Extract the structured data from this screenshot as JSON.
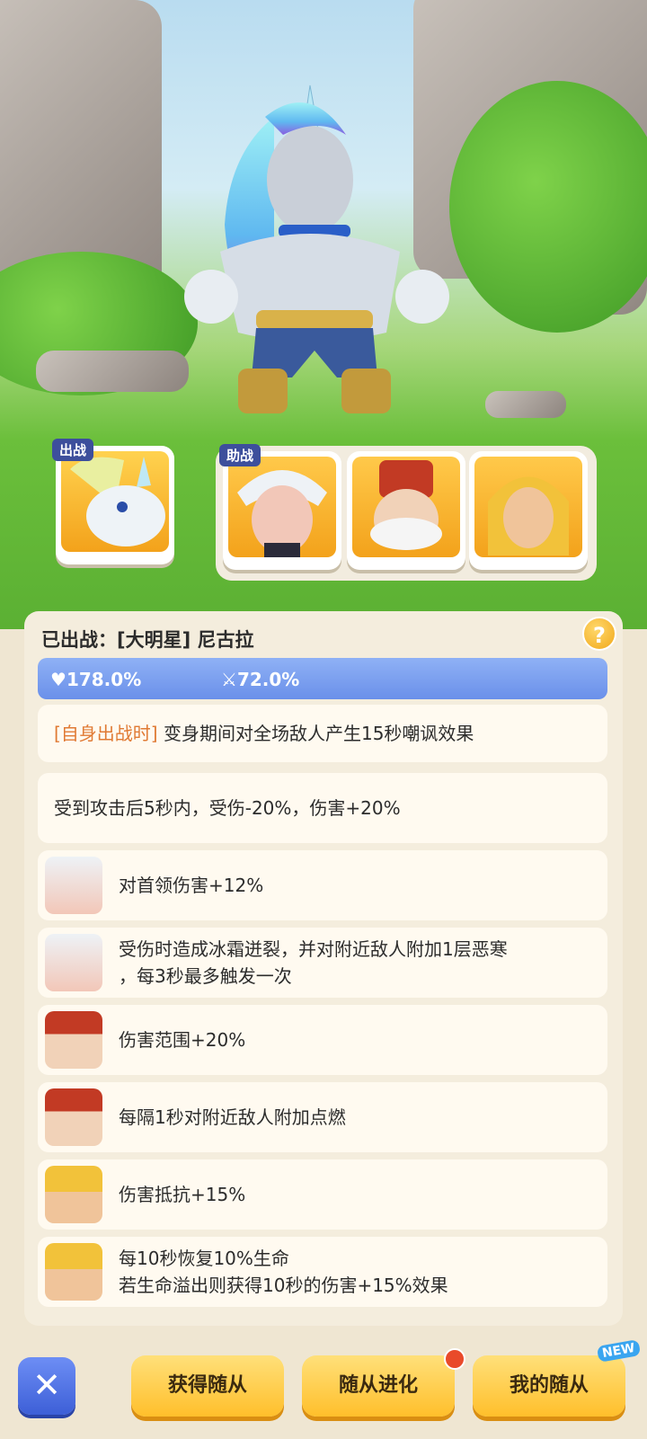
{
  "team": {
    "main_tag": "出战",
    "assist_tag": "助战"
  },
  "info": {
    "title": "已出战：[大明星] 尼古拉",
    "help_symbol": "?",
    "stats": {
      "hp": "178.0%",
      "atk": "72.0%"
    },
    "skills": [
      {
        "prefix": "[自身出战时]",
        "text": " 变身期间对全场敌人产生15秒嘲讽效果"
      },
      {
        "text": "受到攻击后5秒内，受伤-20%，伤害+20%"
      },
      {
        "text": "对首领伤害+12%",
        "portrait": "white-hair-hero"
      },
      {
        "line1": "受伤时造成冰霜迸裂，并对附近敌人附加1层恶寒",
        "line2": "，每3秒最多触发一次",
        "portrait": "white-hair-hero"
      },
      {
        "text": "伤害范围+20%",
        "portrait": "red-hat-old-man"
      },
      {
        "text": "每隔1秒对附近敌人附加点燃",
        "portrait": "red-hat-old-man"
      },
      {
        "text": "伤害抵抗+15%",
        "portrait": "golden-helmet-warrior"
      },
      {
        "line1": "每10秒恢复10%生命",
        "line2": "若生命溢出则获得10秒的伤害+15%效果",
        "portrait": "golden-helmet-warrior"
      }
    ]
  },
  "buttons": {
    "get": "获得随从",
    "evolve": "随从进化",
    "mine": "我的随从",
    "new_badge": "NEW"
  },
  "colors": {
    "accent_blue": "#6a90ea",
    "button_yellow": "#ffbf2b",
    "highlight_orange": "#e07a34"
  }
}
